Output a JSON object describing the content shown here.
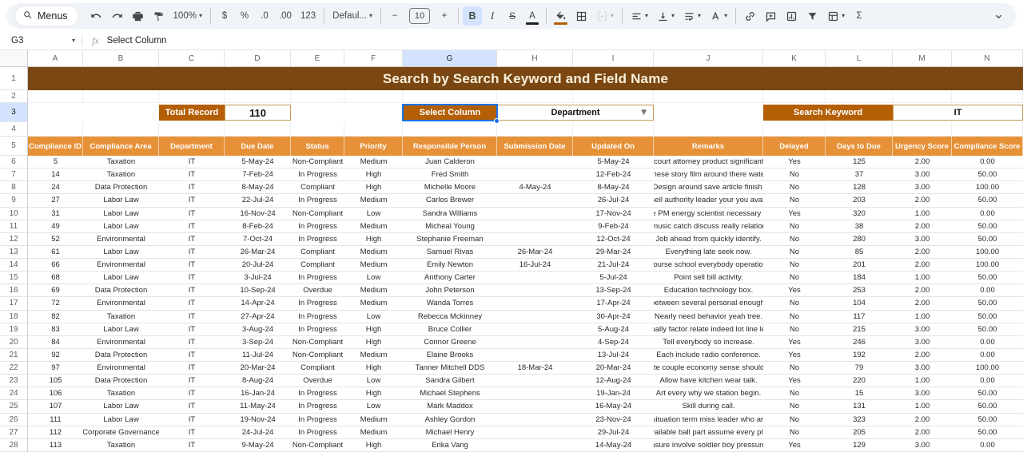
{
  "colors": {
    "banner_bg": "#7a4712",
    "banner_text": "#faf0dc",
    "button_bg": "#b45f06",
    "table_header_bg": "#e69138",
    "selection": "#1a73e8",
    "widget_border": "#c79a55"
  },
  "formula_bar": {
    "cell_ref": "G3",
    "fx_label": "fx",
    "formula": "Select Column"
  },
  "toolbar": {
    "menus_label": "Menus",
    "items": [
      {
        "type": "pill",
        "name": "menus-button",
        "icon": "search",
        "label": "Menus"
      },
      {
        "type": "icon",
        "name": "undo-button",
        "icon": "undo"
      },
      {
        "type": "icon",
        "name": "redo-button",
        "icon": "redo"
      },
      {
        "type": "icon",
        "name": "print-button",
        "icon": "print"
      },
      {
        "type": "icon",
        "name": "paint-format-button",
        "icon": "paint-roller"
      },
      {
        "type": "text",
        "name": "zoom-select",
        "label": "100%",
        "dropdown": true
      },
      {
        "type": "divider"
      },
      {
        "type": "text",
        "name": "format-currency-button",
        "label": "$"
      },
      {
        "type": "text",
        "name": "format-percent-button",
        "label": "%"
      },
      {
        "type": "text",
        "name": "decrease-decimal-button",
        "label": ".0"
      },
      {
        "type": "text",
        "name": "increase-decimal-button",
        "label": ".00"
      },
      {
        "type": "text",
        "name": "number-format-button",
        "label": "123"
      },
      {
        "type": "divider"
      },
      {
        "type": "text",
        "name": "font-family-select",
        "label": "Defaul...",
        "dropdown": true
      },
      {
        "type": "divider"
      },
      {
        "type": "text",
        "name": "decrease-font-size-button",
        "label": "−"
      },
      {
        "type": "box",
        "name": "font-size-input",
        "label": "10"
      },
      {
        "type": "text",
        "name": "increase-font-size-button",
        "label": "+"
      },
      {
        "type": "divider"
      },
      {
        "type": "text",
        "name": "bold-button",
        "label": "B",
        "style": "b",
        "active": true
      },
      {
        "type": "text",
        "name": "italic-button",
        "label": "I",
        "style": "i"
      },
      {
        "type": "text",
        "name": "strikethrough-button",
        "label": "S",
        "style": "s"
      },
      {
        "type": "text",
        "name": "text-color-button",
        "label": "A",
        "underbar": "#202124"
      },
      {
        "type": "divider"
      },
      {
        "type": "icon",
        "name": "fill-color-button",
        "icon": "bucket",
        "underbar": "#b45f06"
      },
      {
        "type": "icon",
        "name": "borders-button",
        "icon": "borders"
      },
      {
        "type": "icon",
        "name": "merge-cells-button",
        "icon": "merge",
        "dropdown": true,
        "disabled": true
      },
      {
        "type": "divider"
      },
      {
        "type": "icon",
        "name": "horizontal-align-button",
        "icon": "align-left",
        "dropdown": true
      },
      {
        "type": "icon",
        "name": "vertical-align-button",
        "icon": "valign",
        "dropdown": true
      },
      {
        "type": "icon",
        "name": "text-wrap-button",
        "icon": "wrap",
        "dropdown": true
      },
      {
        "type": "icon",
        "name": "text-rotation-button",
        "icon": "rotate",
        "dropdown": true
      },
      {
        "type": "divider"
      },
      {
        "type": "icon",
        "name": "insert-link-button",
        "icon": "link"
      },
      {
        "type": "icon",
        "name": "insert-comment-button",
        "icon": "comment"
      },
      {
        "type": "icon",
        "name": "insert-chart-button",
        "icon": "chart"
      },
      {
        "type": "icon",
        "name": "create-filter-button",
        "icon": "filter"
      },
      {
        "type": "icon",
        "name": "table-views-button",
        "icon": "table",
        "dropdown": true
      },
      {
        "type": "text",
        "name": "functions-button",
        "label": "Σ"
      }
    ]
  },
  "columns": [
    "A",
    "B",
    "C",
    "D",
    "E",
    "F",
    "G",
    "H",
    "I",
    "J",
    "K",
    "L",
    "M",
    "N"
  ],
  "selection": {
    "cell": "G3",
    "column": "G",
    "row": 3,
    "row_count": 28
  },
  "banner": {
    "title": "Search by Search Keyword and Field Name"
  },
  "widgets": {
    "total_record_label": "Total Record",
    "total_record_value": "110",
    "select_column_label": "Select Column",
    "select_column_value": "Department",
    "search_keyword_label": "Search Keyword",
    "search_keyword_value": "IT"
  },
  "table": {
    "headers": [
      "Compliance ID",
      "Compliance Area",
      "Department",
      "Due Date",
      "Status",
      "Priority",
      "Responsible Person",
      "Submission Date",
      "Updated On",
      "Remarks",
      "Delayed",
      "Days to Due",
      "Urgency Score",
      "Compliance Score"
    ],
    "rows": [
      [
        "5",
        "Taxation",
        "IT",
        "5-May-24",
        "Non-Compliant",
        "Medium",
        "Juan Calderon",
        "",
        "5-May-24",
        "in court attorney product significant w",
        "Yes",
        "125",
        "2.00",
        "0.00"
      ],
      [
        "14",
        "Taxation",
        "IT",
        "7-Feb-24",
        "In Progress",
        "High",
        "Fred Smith",
        "",
        "12-Feb-24",
        "These story film around there water.",
        "No",
        "37",
        "3.00",
        "50.00"
      ],
      [
        "24",
        "Data Protection",
        "IT",
        "8-May-24",
        "Compliant",
        "High",
        "Michelle Moore",
        "4-May-24",
        "8-May-24",
        "Design around save article finish.",
        "No",
        "128",
        "3.00",
        "100.00"
      ],
      [
        "27",
        "Labor Law",
        "IT",
        "22-Jul-24",
        "In Progress",
        "Medium",
        "Carlos Brewer",
        "",
        "26-Jul-24",
        "t sell authority leader your you availa",
        "No",
        "203",
        "2.00",
        "50.00"
      ],
      [
        "31",
        "Labor Law",
        "IT",
        "16-Nov-24",
        "Non-Compliant",
        "Low",
        "Sandra Williams",
        "",
        "17-Nov-24",
        "ide PM energy scientist necessary int",
        "Yes",
        "320",
        "1.00",
        "0.00"
      ],
      [
        "49",
        "Labor Law",
        "IT",
        "8-Feb-24",
        "In Progress",
        "Medium",
        "Micheal Young",
        "",
        "9-Feb-24",
        "r music catch discuss really relations",
        "No",
        "38",
        "2.00",
        "50.00"
      ],
      [
        "52",
        "Environmental",
        "IT",
        "7-Oct-24",
        "In Progress",
        "High",
        "Stephanie Freeman",
        "",
        "12-Oct-24",
        "Job ahead from quickly identify.",
        "No",
        "280",
        "3.00",
        "50.00"
      ],
      [
        "61",
        "Labor Law",
        "IT",
        "26-Mar-24",
        "Compliant",
        "Medium",
        "Samuel Rivas",
        "26-Mar-24",
        "29-Mar-24",
        "Everything late seek now.",
        "No",
        "85",
        "2.00",
        "100.00"
      ],
      [
        "66",
        "Environmental",
        "IT",
        "20-Jul-24",
        "Compliant",
        "Medium",
        "Emily Newton",
        "16-Jul-24",
        "21-Jul-24",
        "Course school everybody operation.",
        "No",
        "201",
        "2.00",
        "100.00"
      ],
      [
        "68",
        "Labor Law",
        "IT",
        "3-Jul-24",
        "In Progress",
        "Low",
        "Anthony Carter",
        "",
        "5-Jul-24",
        "Point sell bill activity.",
        "No",
        "184",
        "1.00",
        "50.00"
      ],
      [
        "69",
        "Data Protection",
        "IT",
        "10-Sep-24",
        "Overdue",
        "Medium",
        "John Peterson",
        "",
        "13-Sep-24",
        "Education technology box.",
        "Yes",
        "253",
        "2.00",
        "0.00"
      ],
      [
        "72",
        "Environmental",
        "IT",
        "14-Apr-24",
        "In Progress",
        "Medium",
        "Wanda Torres",
        "",
        "17-Apr-24",
        "r between several personal enough b",
        "No",
        "104",
        "2.00",
        "50.00"
      ],
      [
        "82",
        "Taxation",
        "IT",
        "27-Apr-24",
        "In Progress",
        "Low",
        "Rebecca Mckinney",
        "",
        "30-Apr-24",
        "Nearly need behavior yeah tree.",
        "No",
        "117",
        "1.00",
        "50.00"
      ],
      [
        "83",
        "Labor Law",
        "IT",
        "3-Aug-24",
        "In Progress",
        "High",
        "Bruce Collier",
        "",
        "5-Aug-24",
        "sually factor relate indeed lot line lea",
        "No",
        "215",
        "3.00",
        "50.00"
      ],
      [
        "84",
        "Environmental",
        "IT",
        "3-Sep-24",
        "Non-Compliant",
        "High",
        "Connor Greene",
        "",
        "4-Sep-24",
        "Tell everybody so increase.",
        "Yes",
        "246",
        "3.00",
        "0.00"
      ],
      [
        "92",
        "Data Protection",
        "IT",
        "11-Jul-24",
        "Non-Compliant",
        "Medium",
        "Elaine Brooks",
        "",
        "13-Jul-24",
        "Each include radio conference.",
        "Yes",
        "192",
        "2.00",
        "0.00"
      ],
      [
        "97",
        "Environmental",
        "IT",
        "20-Mar-24",
        "Compliant",
        "High",
        "Tanner Mitchell DDS",
        "18-Mar-24",
        "20-Mar-24",
        "spite couple economy sense should ra",
        "No",
        "79",
        "3.00",
        "100.00"
      ],
      [
        "105",
        "Data Protection",
        "IT",
        "8-Aug-24",
        "Overdue",
        "Low",
        "Sandra Gilbert",
        "",
        "12-Aug-24",
        "Allow have kitchen wear talk.",
        "Yes",
        "220",
        "1.00",
        "0.00"
      ],
      [
        "106",
        "Taxation",
        "IT",
        "16-Jan-24",
        "In Progress",
        "High",
        "Michael Stephens",
        "",
        "19-Jan-24",
        "Art every why we station begin.",
        "No",
        "15",
        "3.00",
        "50.00"
      ],
      [
        "107",
        "Labor Law",
        "IT",
        "11-May-24",
        "In Progress",
        "Low",
        "Mark Maddox",
        "",
        "16-May-24",
        "Skill during call.",
        "No",
        "131",
        "1.00",
        "50.00"
      ],
      [
        "111",
        "Labor Law",
        "IT",
        "19-Nov-24",
        "In Progress",
        "Medium",
        "Ashley Gordon",
        "",
        "23-Nov-24",
        "s situation term miss leader who artic",
        "No",
        "323",
        "2.00",
        "50.00"
      ],
      [
        "112",
        "Corporate Governance",
        "IT",
        "24-Jul-24",
        "In Progress",
        "Medium",
        "Michael Henry",
        "",
        "29-Jul-24",
        "Available ball part assume every plan",
        "No",
        "205",
        "2.00",
        "50.00"
      ],
      [
        "113",
        "Taxation",
        "IT",
        "9-May-24",
        "Non-Compliant",
        "High",
        "Erika Vang",
        "",
        "14-May-24",
        "easure involve soldier boy pressure t",
        "Yes",
        "129",
        "3.00",
        "0.00"
      ]
    ]
  }
}
